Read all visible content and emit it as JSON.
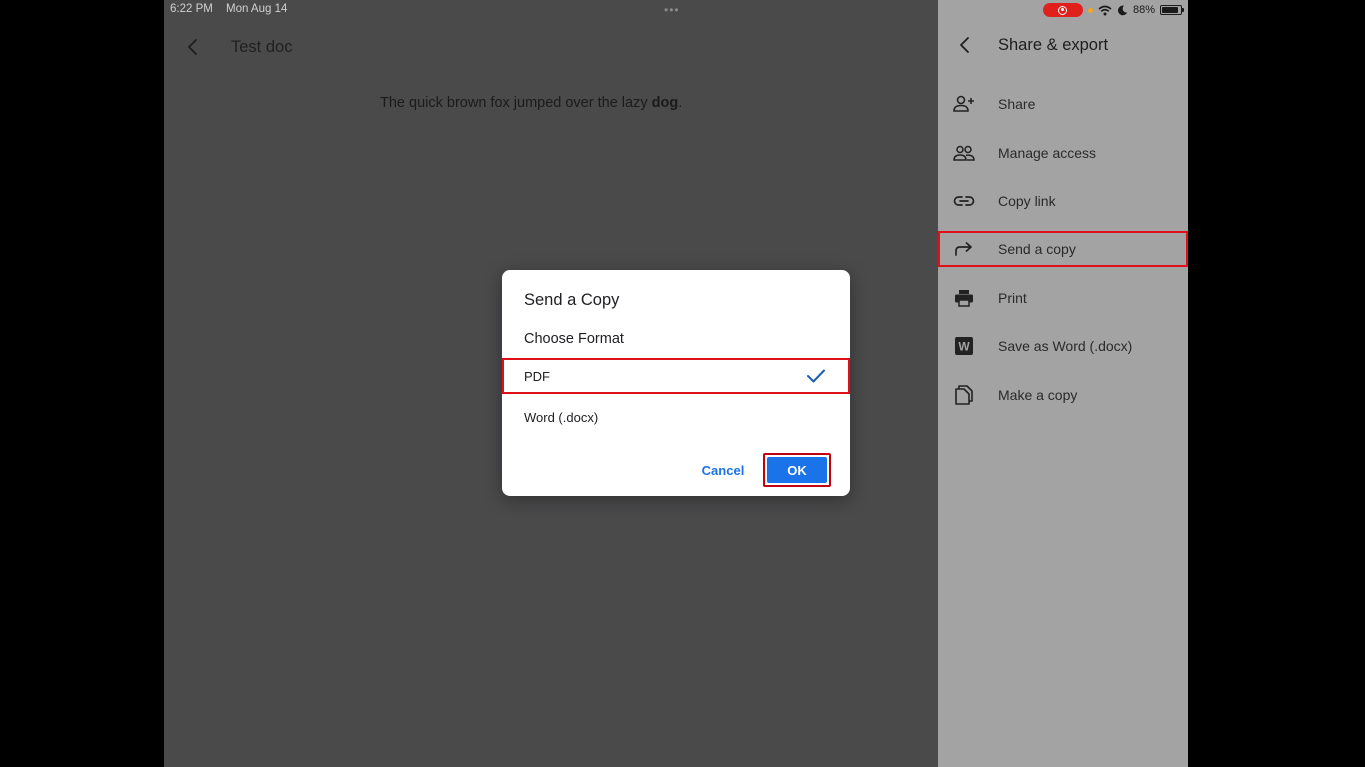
{
  "status_bar": {
    "time": "6:22 PM",
    "date": "Mon Aug 14",
    "battery": "88%"
  },
  "document": {
    "title": "Test doc",
    "body_prefix": "The quick brown fox jumped over the lazy ",
    "body_bold": "dog",
    "body_suffix": "."
  },
  "panel": {
    "title": "Share & export",
    "items": [
      {
        "label": "Share",
        "icon": "person-add-icon"
      },
      {
        "label": "Manage access",
        "icon": "people-icon"
      },
      {
        "label": "Copy link",
        "icon": "link-icon"
      },
      {
        "label": "Send a copy",
        "icon": "forward-arrow-icon",
        "highlighted": true
      },
      {
        "label": "Print",
        "icon": "printer-icon"
      },
      {
        "label": "Save as Word (.docx)",
        "icon": "word-icon"
      },
      {
        "label": "Make a copy",
        "icon": "copy-icon"
      }
    ]
  },
  "dialog": {
    "title": "Send a Copy",
    "subtitle": "Choose Format",
    "options": [
      {
        "label": "PDF",
        "selected": true
      },
      {
        "label": "Word (.docx)",
        "selected": false
      }
    ],
    "cancel_label": "Cancel",
    "ok_label": "OK"
  },
  "colors": {
    "accent": "#1a73e8",
    "highlight": "#e0101a",
    "panel_bg": "#a3a3a3",
    "doc_bg": "#4a4a4b"
  }
}
